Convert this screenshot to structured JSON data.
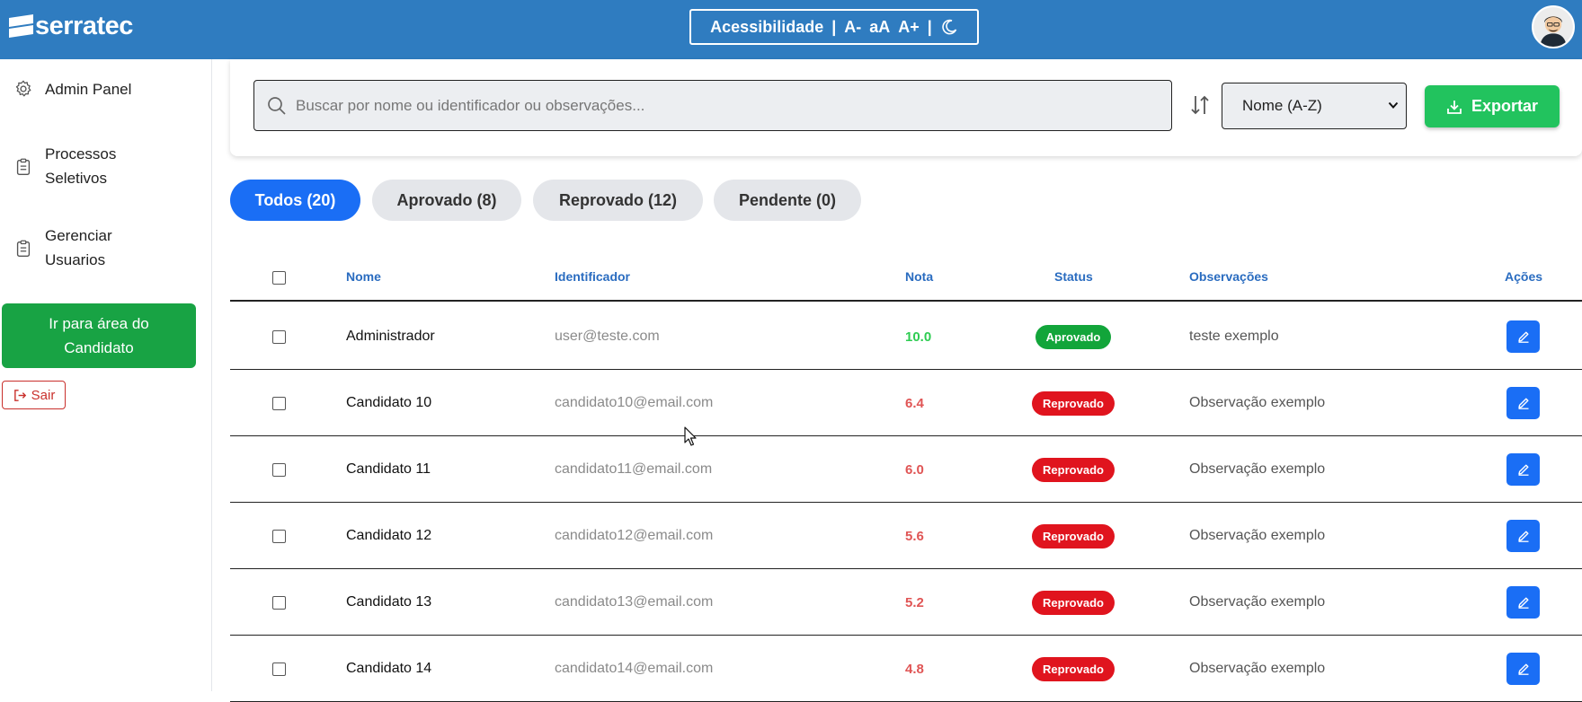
{
  "app": {
    "logo_text": "serratec"
  },
  "accessibility": {
    "label": "Acessibilidade",
    "sep": "|",
    "decrease": "A-",
    "reset": "aA",
    "increase": "A+"
  },
  "sidebar": {
    "items": [
      {
        "label_lines": [
          "Admin Panel"
        ],
        "icon": "gear-icon"
      },
      {
        "label_lines": [
          "Processos",
          "Seletivos"
        ],
        "icon": "clipboard-icon"
      },
      {
        "label_lines": [
          "Gerenciar",
          "Usuarios"
        ],
        "icon": "clipboard-icon"
      }
    ],
    "candidate_area": {
      "line1": "Ir para área do",
      "line2": "Candidato"
    },
    "logout": "Sair"
  },
  "toolbar": {
    "search_placeholder": "Buscar por nome ou identificador ou observações...",
    "sort_selected": "Nome (A-Z)",
    "export_label": "Exportar"
  },
  "tabs": [
    {
      "label": "Todos (20)",
      "active": true
    },
    {
      "label": "Aprovado (8)",
      "active": false
    },
    {
      "label": "Reprovado (12)",
      "active": false
    },
    {
      "label": "Pendente (0)",
      "active": false
    }
  ],
  "table": {
    "headers": {
      "nome": "Nome",
      "identificador": "Identificador",
      "nota": "Nota",
      "status": "Status",
      "observacoes": "Observações",
      "acoes": "Ações"
    },
    "rows": [
      {
        "nome": "Administrador",
        "identificador": "user@teste.com",
        "nota": "10.0",
        "status": "Aprovado",
        "observacoes": "teste exemplo"
      },
      {
        "nome": "Candidato 10",
        "identificador": "candidato10@email.com",
        "nota": "6.4",
        "status": "Reprovado",
        "observacoes": "Observação exemplo"
      },
      {
        "nome": "Candidato 11",
        "identificador": "candidato11@email.com",
        "nota": "6.0",
        "status": "Reprovado",
        "observacoes": "Observação exemplo"
      },
      {
        "nome": "Candidato 12",
        "identificador": "candidato12@email.com",
        "nota": "5.6",
        "status": "Reprovado",
        "observacoes": "Observação exemplo"
      },
      {
        "nome": "Candidato 13",
        "identificador": "candidato13@email.com",
        "nota": "5.2",
        "status": "Reprovado",
        "observacoes": "Observação exemplo"
      },
      {
        "nome": "Candidato 14",
        "identificador": "candidato14@email.com",
        "nota": "4.8",
        "status": "Reprovado",
        "observacoes": "Observação exemplo"
      }
    ]
  },
  "colors": {
    "header_bg": "#2f7cc0",
    "primary": "#1a6ef5",
    "success": "#18a344",
    "export_green": "#22c35e",
    "approved_badge": "#12a53a",
    "rejected_badge": "#e0141e",
    "grade_pass": "#2ecc52",
    "grade_fail": "#e05555"
  }
}
